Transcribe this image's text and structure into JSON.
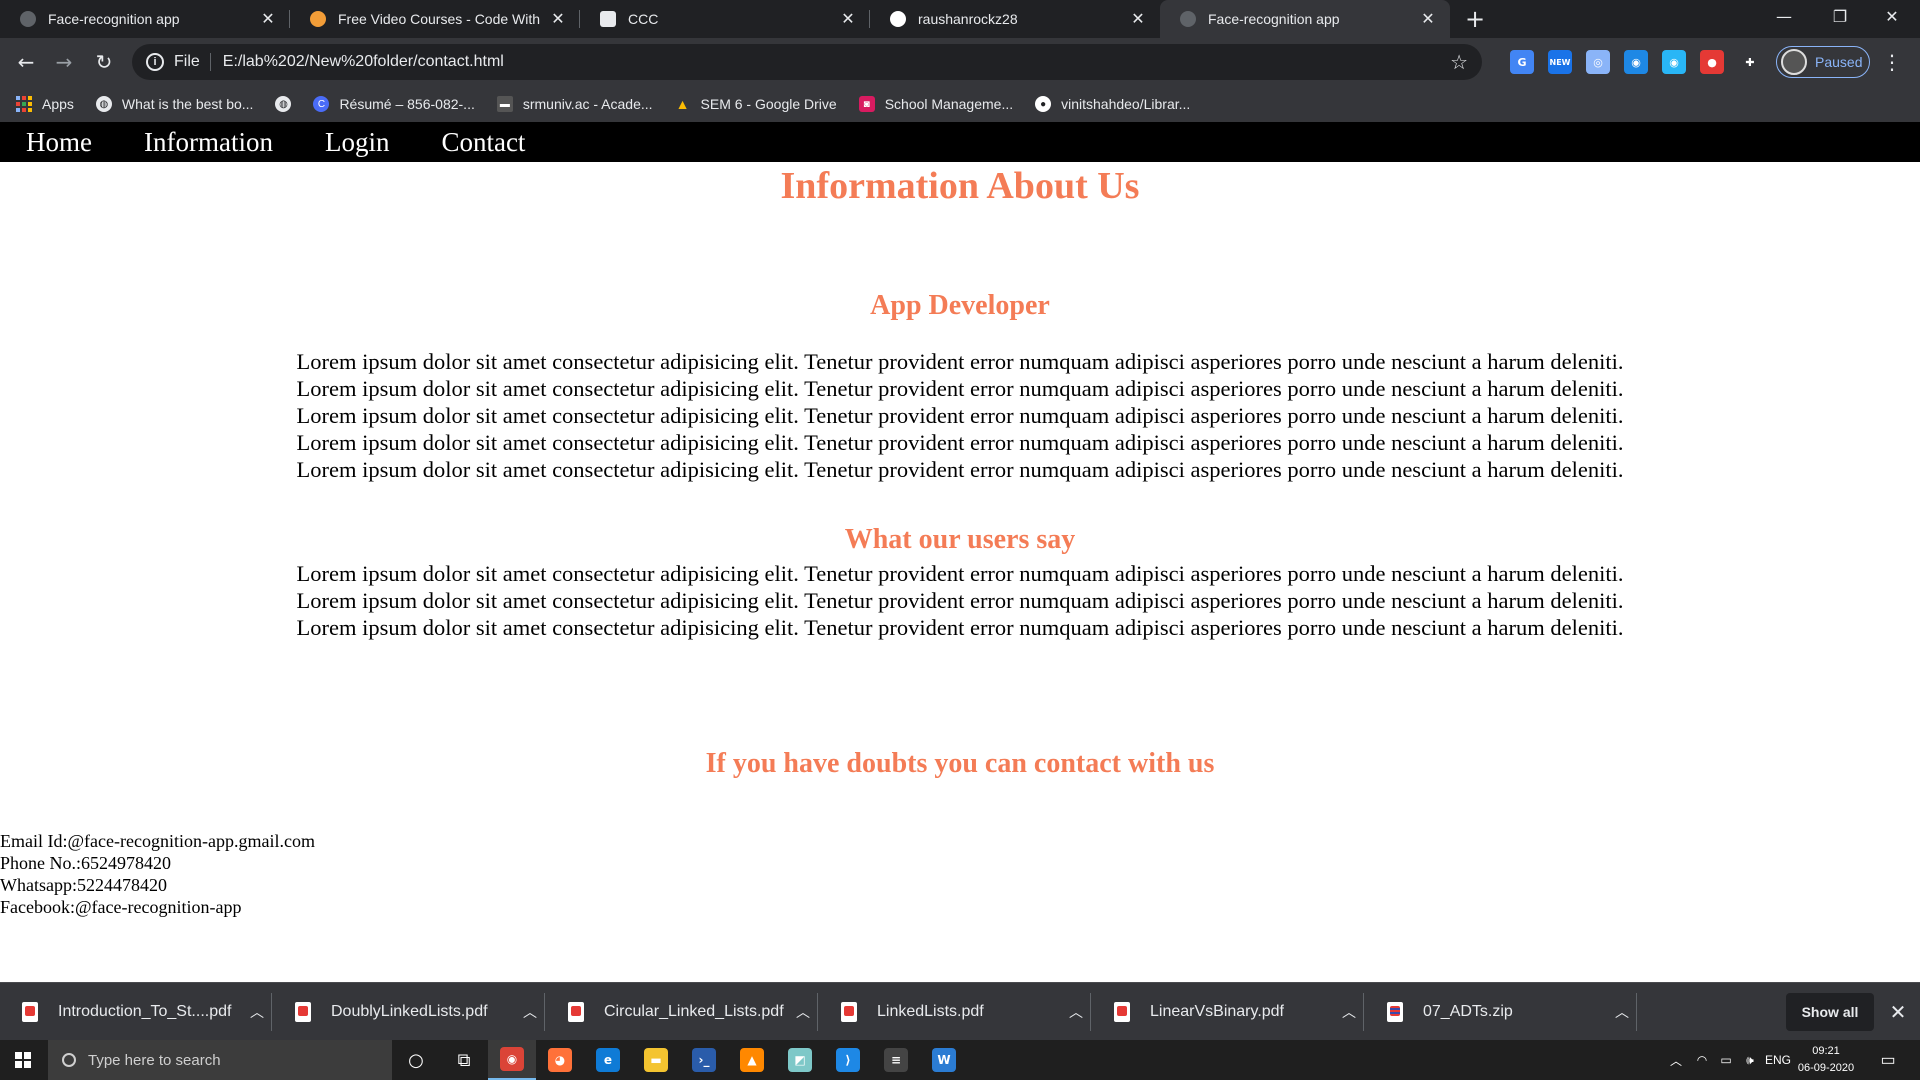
{
  "browser": {
    "tabs": [
      {
        "title": "Face-recognition app",
        "favicon_color": "#5f6368"
      },
      {
        "title": "Free Video Courses - Code With",
        "favicon_color": "#f29d38"
      },
      {
        "title": "CCC",
        "favicon_color": "#e8eaed"
      },
      {
        "title": "raushanrockz28",
        "favicon_color": "#ffffff"
      },
      {
        "title": "Face-recognition app",
        "favicon_color": "#5f6368"
      }
    ],
    "active_tab": 4,
    "address": {
      "scheme": "File",
      "url": "E:/lab%202/New%20folder/contact.html"
    },
    "profile_label": "Paused",
    "bookmarks": [
      {
        "label": "Apps",
        "icon": "apps-grid-icon"
      },
      {
        "label": "What is the best bo...",
        "icon": "globe-icon",
        "color": "#e8eaed"
      },
      {
        "label": "",
        "icon": "globe-icon",
        "color": "#e8eaed"
      },
      {
        "label": "Résumé – 856-082-...",
        "icon": "canva-icon",
        "color": "#4a6cf7"
      },
      {
        "label": "srmuniv.ac - Acade...",
        "icon": "page-icon",
        "color": "#555555"
      },
      {
        "label": "SEM 6 - Google Drive",
        "icon": "drive-icon",
        "color": "#fbbc04"
      },
      {
        "label": "School Manageme...",
        "icon": "school-icon",
        "color": "#d81b60"
      },
      {
        "label": "vinitshahdeo/Librar...",
        "icon": "github-icon",
        "color": "#ffffff"
      }
    ],
    "extensions": [
      {
        "name": "translate-icon",
        "color": "#4285f4",
        "text": "G"
      },
      {
        "name": "new-badge-icon",
        "color": "#1a73e8",
        "text": "NEW"
      },
      {
        "name": "extension-icon-1",
        "color": "#8ab4f8",
        "text": "◎"
      },
      {
        "name": "extension-icon-2",
        "color": "#1e88e5",
        "text": "◉"
      },
      {
        "name": "extension-icon-3",
        "color": "#29b6f6",
        "text": "◉"
      },
      {
        "name": "extension-icon-4",
        "color": "#e53935",
        "text": "●"
      },
      {
        "name": "puzzle-icon",
        "color": "#35363a",
        "text": "✚"
      }
    ]
  },
  "site": {
    "nav": [
      "Home",
      "Information",
      "Login",
      "Contact"
    ],
    "main_heading": "Information About Us",
    "developer_heading": "App Developer",
    "developer_lines": [
      "Lorem ipsum dolor sit amet consectetur adipisicing elit. Tenetur provident error numquam adipisci asperiores porro unde nesciunt a harum deleniti.",
      "Lorem ipsum dolor sit amet consectetur adipisicing elit. Tenetur provident error numquam adipisci asperiores porro unde nesciunt a harum deleniti.",
      "Lorem ipsum dolor sit amet consectetur adipisicing elit. Tenetur provident error numquam adipisci asperiores porro unde nesciunt a harum deleniti.",
      "Lorem ipsum dolor sit amet consectetur adipisicing elit. Tenetur provident error numquam adipisci asperiores porro unde nesciunt a harum deleniti.",
      "Lorem ipsum dolor sit amet consectetur adipisicing elit. Tenetur provident error numquam adipisci asperiores porro unde nesciunt a harum deleniti."
    ],
    "users_heading": "What our users say",
    "users_lines": [
      "Lorem ipsum dolor sit amet consectetur adipisicing elit. Tenetur provident error numquam adipisci asperiores porro unde nesciunt a harum deleniti.",
      "Lorem ipsum dolor sit amet consectetur adipisicing elit. Tenetur provident error numquam adipisci asperiores porro unde nesciunt a harum deleniti.",
      "Lorem ipsum dolor sit amet consectetur adipisicing elit. Tenetur provident error numquam adipisci asperiores porro unde nesciunt a harum deleniti."
    ],
    "contact_heading": "If you have doubts you can contact with us",
    "contact": {
      "email": "Email Id:@face-recognition-app.gmail.com",
      "phone": "Phone No.:6524978420",
      "whatsapp": "Whatsapp:5224478420",
      "facebook": "Facebook:@face-recognition-app"
    },
    "accent_color": "#f47c56"
  },
  "downloads": {
    "items": [
      {
        "name": "Introduction_To_St....pdf",
        "type": "pdf"
      },
      {
        "name": "DoublyLinkedLists.pdf",
        "type": "pdf"
      },
      {
        "name": "Circular_Linked_Lists.pdf",
        "type": "pdf"
      },
      {
        "name": "LinkedLists.pdf",
        "type": "pdf"
      },
      {
        "name": "LinearVsBinary.pdf",
        "type": "pdf"
      },
      {
        "name": "07_ADTs.zip",
        "type": "zip"
      }
    ],
    "show_all_label": "Show all"
  },
  "taskbar": {
    "search_placeholder": "Type here to search",
    "apps": [
      {
        "name": "cortana-icon",
        "color": "transparent",
        "text": "○"
      },
      {
        "name": "task-view-icon",
        "color": "transparent",
        "text": "⧉"
      },
      {
        "name": "chrome-icon",
        "color": "#db4437",
        "text": "◉",
        "active": true
      },
      {
        "name": "firefox-icon",
        "color": "#ff7139",
        "text": "◕"
      },
      {
        "name": "edge-icon",
        "color": "#0f7bd6",
        "text": "e"
      },
      {
        "name": "file-explorer-icon",
        "color": "#f4c430",
        "text": "▬"
      },
      {
        "name": "powershell-icon",
        "color": "#2a5caa",
        "text": "›_"
      },
      {
        "name": "vlc-icon",
        "color": "#ff8800",
        "text": "▲"
      },
      {
        "name": "notes-icon",
        "color": "#7ec8c8",
        "text": "◩"
      },
      {
        "name": "vscode-icon",
        "color": "#1e88e5",
        "text": "⟩"
      },
      {
        "name": "terminal-icon",
        "color": "#444444",
        "text": "≡"
      },
      {
        "name": "word-icon",
        "color": "#2b7cd3",
        "text": "W"
      }
    ],
    "tray_language": "ENG",
    "time": "09:21",
    "date": "06-09-2020"
  }
}
